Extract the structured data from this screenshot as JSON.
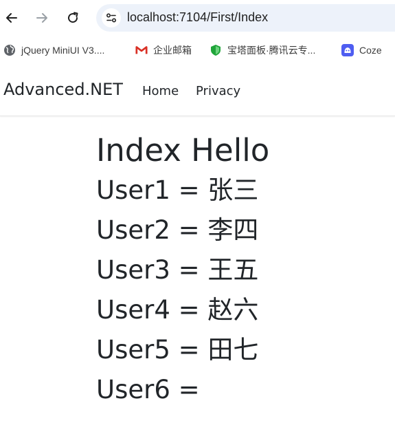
{
  "browser": {
    "url": "localhost:7104/First/Index",
    "nav_icons": [
      "back-arrow-icon",
      "forward-arrow-icon",
      "reload-icon",
      "site-info-icon"
    ],
    "bookmarks": [
      {
        "label": "jQuery MiniUI V3....",
        "icon": "globe-icon",
        "color": "#5f6368"
      },
      {
        "label": "企业邮箱",
        "icon": "mail-m-icon",
        "color": "#d93025"
      },
      {
        "label": "宝塔面板·腾讯云专...",
        "icon": "shield-icon",
        "color": "#20a53a"
      },
      {
        "label": "Coze",
        "icon": "coze-icon",
        "color": "#4e5df1"
      }
    ]
  },
  "site": {
    "brand": "Advanced.NET",
    "nav": [
      {
        "label": "Home"
      },
      {
        "label": "Privacy"
      }
    ]
  },
  "main": {
    "heading": "Index Hello",
    "users": [
      {
        "text": "User1 = 张三"
      },
      {
        "text": "User2 = 李四"
      },
      {
        "text": "User3 = 王五"
      },
      {
        "text": "User4 = 赵六"
      },
      {
        "text": "User5 = 田七"
      },
      {
        "text": "User6 ="
      }
    ]
  }
}
